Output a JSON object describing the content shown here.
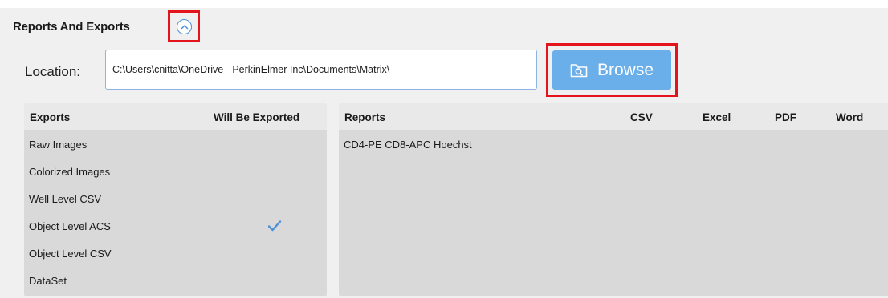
{
  "section": {
    "title": "Reports And Exports"
  },
  "location": {
    "label": "Location:",
    "value": "C:\\Users\\cnitta\\OneDrive - PerkinElmer Inc\\Documents\\Matrix\\"
  },
  "browse": {
    "label": "Browse"
  },
  "exports": {
    "headers": [
      "Exports",
      "Will Be Exported"
    ],
    "rows": [
      {
        "name": "Raw Images",
        "exported": false
      },
      {
        "name": "Colorized Images",
        "exported": false
      },
      {
        "name": "Well Level CSV",
        "exported": false
      },
      {
        "name": "Object Level ACS",
        "exported": true
      },
      {
        "name": "Object Level CSV",
        "exported": false
      },
      {
        "name": "DataSet",
        "exported": false
      }
    ]
  },
  "reports": {
    "headers": [
      "Reports",
      "CSV",
      "Excel",
      "PDF",
      "Word"
    ],
    "rows": [
      {
        "name": "CD4-PE CD8-APC Hoechst"
      }
    ]
  },
  "colors": {
    "accent": "#6aaeea",
    "highlight": "#e3141b",
    "check": "#4a90d9"
  }
}
